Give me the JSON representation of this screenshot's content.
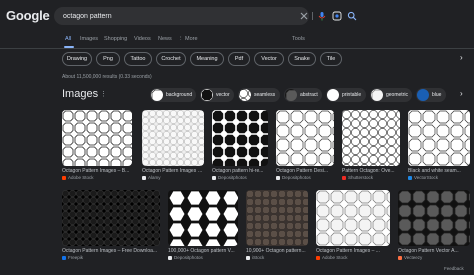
{
  "logo": "Google",
  "search": {
    "value": "octagon pattern",
    "placeholder": ""
  },
  "tabs": [
    "All",
    "Images",
    "Shopping",
    "Videos",
    "News",
    "⋮ More"
  ],
  "tools": "Tools",
  "chips": [
    "Drawing",
    "Png",
    "Tattoo",
    "Crochet",
    "Meaning",
    "Pdf",
    "Vector",
    "Snake",
    "Tile"
  ],
  "results_count": "About 11,500,000 results (0.33 seconds)",
  "images": {
    "heading": "Images",
    "refine": [
      "background",
      "vector",
      "seamless",
      "abstract",
      "printable",
      "geometric",
      "blue"
    ],
    "row1": [
      {
        "title": "Octagon Pattern Images – B...",
        "source": "Adobe Stock"
      },
      {
        "title": "Octagon Pattern Images – B...",
        "source": "Alamy"
      },
      {
        "title": "Octagon pattern hi-re...",
        "source": "Depositphotos"
      },
      {
        "title": "Octagon Pattern Desi...",
        "source": "Depositphotos"
      },
      {
        "title": "Pattern Octagon: Ove...",
        "source": "Shutterstock"
      },
      {
        "title": "Black and white seam...",
        "source": "VectorStock"
      }
    ],
    "row2": [
      {
        "title": "Octagon Pattern Images – Free Downloa...",
        "source": "Freepik"
      },
      {
        "title": "100,000+ Octagon pattern V...",
        "source": "Depositphotos"
      },
      {
        "title": "10,900+ Octagon pattern...",
        "source": "iStock"
      },
      {
        "title": "Octagon Pattern Images – ...",
        "source": "Adobe Stock"
      },
      {
        "title": "Octagon Pattern Vector A...",
        "source": "Vecteezy"
      }
    ]
  },
  "feedback": "Feedback",
  "colors": {
    "background": "#202124",
    "accent": "#8ab4f8",
    "text": "#bdc1c6"
  }
}
